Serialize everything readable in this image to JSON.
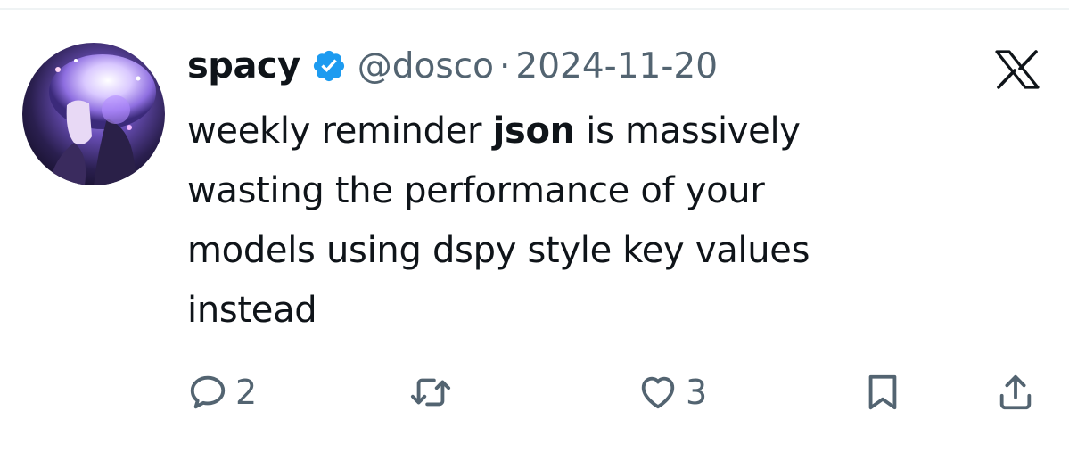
{
  "tweet": {
    "display_name": "spacy",
    "handle": "@dosco",
    "separator": "·",
    "date": "2024-11-20",
    "text_lines": [
      {
        "before": "weekly reminder ",
        "bold": "json",
        "after": " is massively"
      },
      {
        "text": "wasting the performance of your"
      },
      {
        "text": "models using dspy style key values"
      },
      {
        "text": "instead"
      }
    ]
  },
  "icons": {
    "verified": "verified-badge-icon",
    "platform": "x-logo-icon",
    "reply": "reply-icon",
    "retweet": "retweet-icon",
    "like": "heart-icon",
    "bookmark": "bookmark-icon",
    "share": "share-icon"
  },
  "actions": {
    "reply_count": "2",
    "like_count": "3"
  },
  "colors": {
    "verified": "#1d9bf0",
    "secondary_text": "#536471",
    "primary_text": "#0f1419"
  }
}
